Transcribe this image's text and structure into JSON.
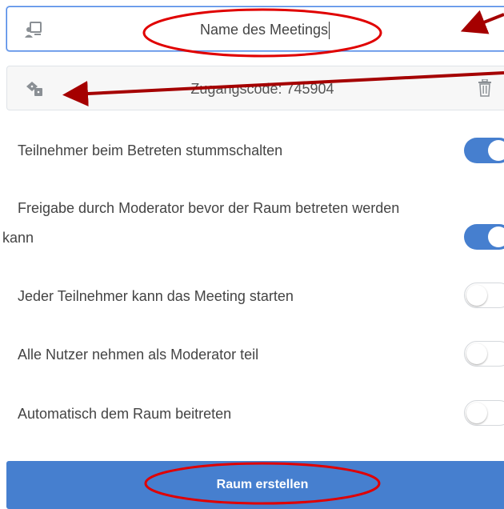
{
  "room_name": {
    "value": "Name des Meetings",
    "icon": "presentation-icon"
  },
  "access_code": {
    "value": "Zugangscode: 745904",
    "icon": "dice-icon",
    "action_icon": "trash-icon"
  },
  "options": [
    {
      "label": "Teilnehmer beim Betreten stummschalten",
      "enabled": true
    },
    {
      "label": "Freigabe durch Moderator bevor der Raum betreten werden",
      "label_continued": "kann",
      "enabled": true
    },
    {
      "label": "Jeder Teilnehmer kann das Meeting starten",
      "enabled": false
    },
    {
      "label": "Alle Nutzer nehmen als Moderator teil",
      "enabled": false
    },
    {
      "label": "Automatisch dem Raum beitreten",
      "enabled": false
    }
  ],
  "create_button": {
    "label": "Raum erstellen"
  },
  "colors": {
    "accent": "#467fcf",
    "annotation_red": "#e00000",
    "arrow_darkred": "#a50000"
  }
}
